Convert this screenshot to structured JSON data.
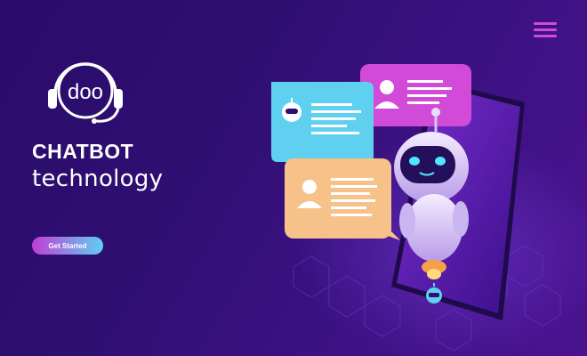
{
  "header": {
    "menu_icon": "hamburger-menu-icon"
  },
  "logo": {
    "text": "doo",
    "icon": "headset-icon"
  },
  "hero": {
    "title": "CHATBOT",
    "subtitle": "technology",
    "cta_label": "Get Started"
  },
  "illustration": {
    "bot_bubble_icon": "robot-icon",
    "user_bubble_icon": "user-icon"
  },
  "colors": {
    "background": "#2f0f72",
    "accent_pink": "#d24bd8",
    "accent_cyan": "#5fd0f0",
    "bubble_peach": "#f6c28a"
  }
}
